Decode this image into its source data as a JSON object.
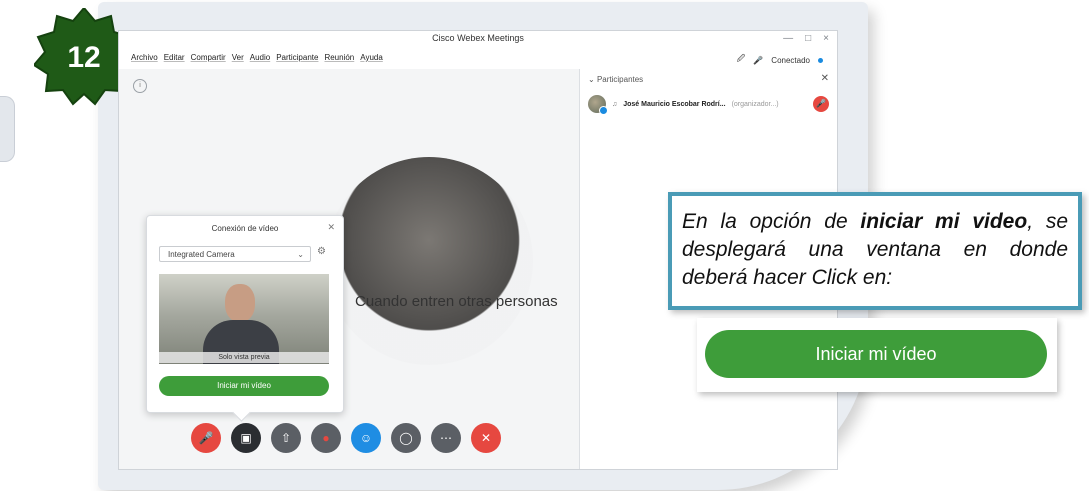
{
  "badge": {
    "number": "12",
    "color": "#1f5a17"
  },
  "window": {
    "title": "Cisco Webex Meetings",
    "controls": [
      "—",
      "□",
      "×"
    ]
  },
  "menu": {
    "items": [
      "Archivo",
      "Editar",
      "Compartir",
      "Ver",
      "Audio",
      "Participante",
      "Reunión",
      "Ayuda"
    ],
    "status": "Conectado",
    "status_color": "#1a8be0"
  },
  "stage": {
    "message": "Cuando entren otras personas",
    "controls": [
      {
        "name": "mute",
        "icon": "mic-off-icon",
        "color": "#e64840"
      },
      {
        "name": "video",
        "icon": "camera-icon",
        "color": "#2a2d31"
      },
      {
        "name": "share",
        "icon": "upload-icon",
        "color": "#5b5f65"
      },
      {
        "name": "record",
        "icon": "record-icon",
        "color": "#5b5f65"
      },
      {
        "name": "participants",
        "icon": "add-user-icon",
        "color": "#1f8de3"
      },
      {
        "name": "chat",
        "icon": "chat-icon",
        "color": "#5b5f65"
      },
      {
        "name": "more",
        "icon": "more-icon",
        "color": "#5b5f65"
      },
      {
        "name": "leave",
        "icon": "close-icon",
        "color": "#e64840"
      }
    ]
  },
  "participants": {
    "header": "Participantes",
    "list": [
      {
        "name": "José Mauricio Escobar Rodrí...",
        "role": "(organizador...)"
      }
    ]
  },
  "video_popup": {
    "title": "Conexión de vídeo",
    "camera": "Integrated Camera",
    "preview_caption": "Solo vista previa",
    "button": "Iniciar mi vídeo"
  },
  "callout": {
    "text_1": "En la opción de ",
    "text_bold": "iniciar mi video",
    "text_2": ", se desplegará una ventana en donde deberá hacer Click en:",
    "border_color": "#4a9bb6"
  },
  "zoom_button": {
    "label": "Iniciar mi vídeo",
    "color": "#3e9d3a"
  }
}
